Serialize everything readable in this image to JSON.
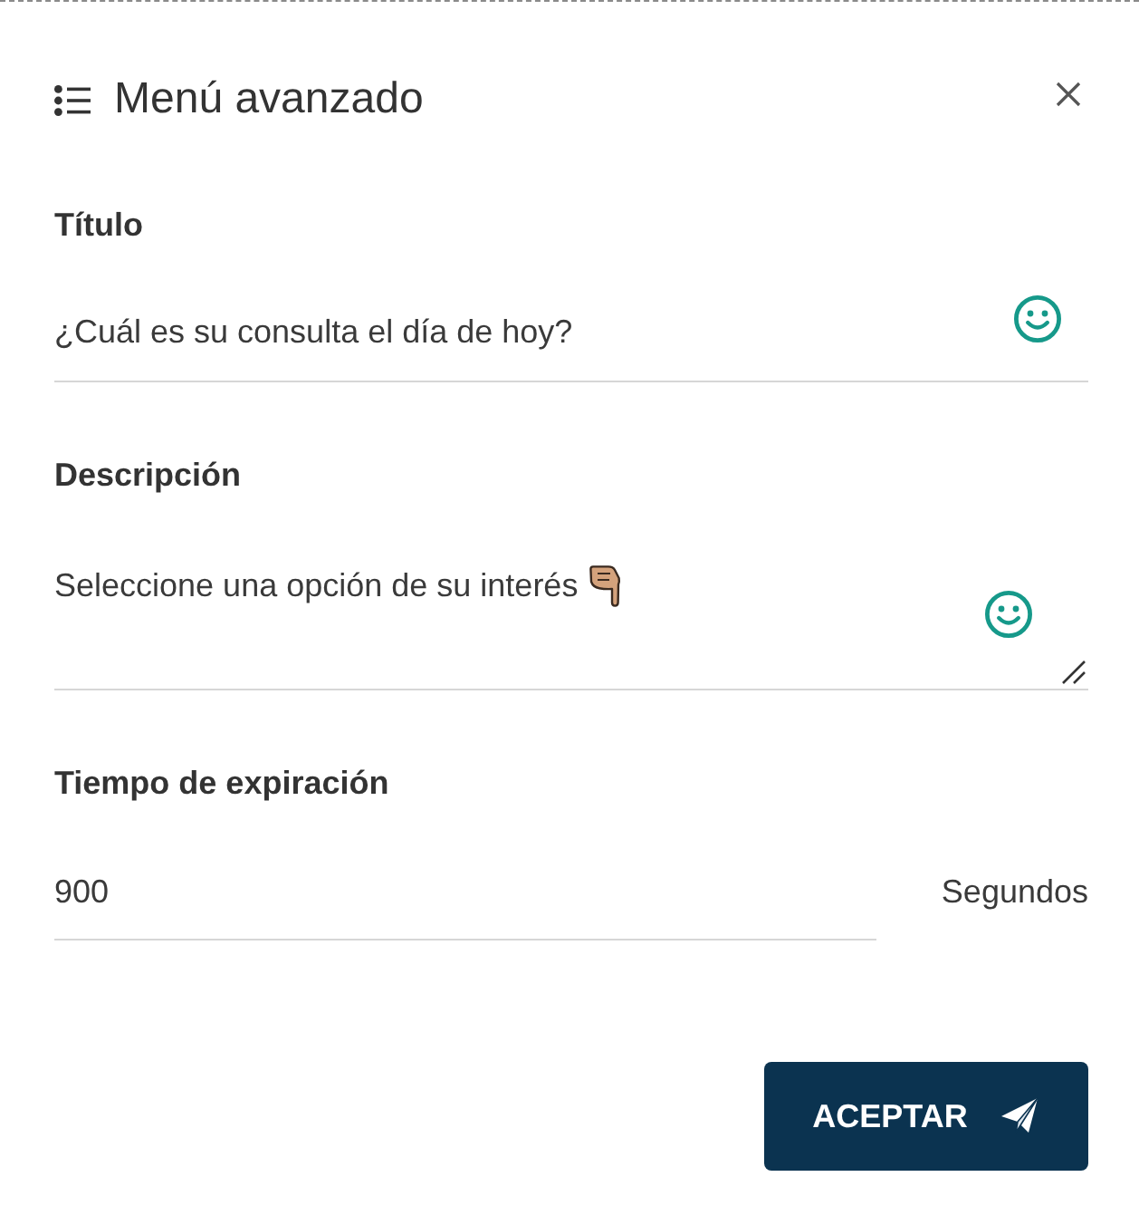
{
  "dialog": {
    "title": "Menú avanzado"
  },
  "fields": [
    {
      "kind": "text",
      "label": "Título",
      "value": "¿Cuál es su consulta el día de hoy?"
    },
    {
      "kind": "textarea",
      "label": "Descripción",
      "value": "Seleccione una opción de su interés"
    },
    {
      "kind": "number",
      "label": "Tiempo de expiración",
      "value": "900",
      "unit": "Segundos"
    }
  ],
  "buttons": [
    {
      "label": "ACEPTAR"
    }
  ]
}
